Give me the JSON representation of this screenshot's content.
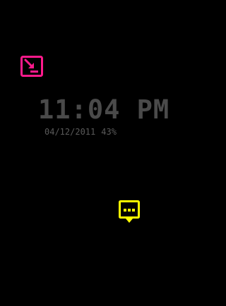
{
  "clock": {
    "time": "11:04 PM",
    "date": "04/12/2011",
    "battery": "43%"
  },
  "icons": {
    "download_notification": "download-to-tray-icon",
    "unread_message": "chat-bubble-ellipsis-icon"
  },
  "colors": {
    "background": "#000000",
    "clock_text": "#4a4a4a",
    "status_text": "#5a5a5a",
    "notification_accent": "#ff1a8c",
    "message_accent": "#ffff00"
  }
}
